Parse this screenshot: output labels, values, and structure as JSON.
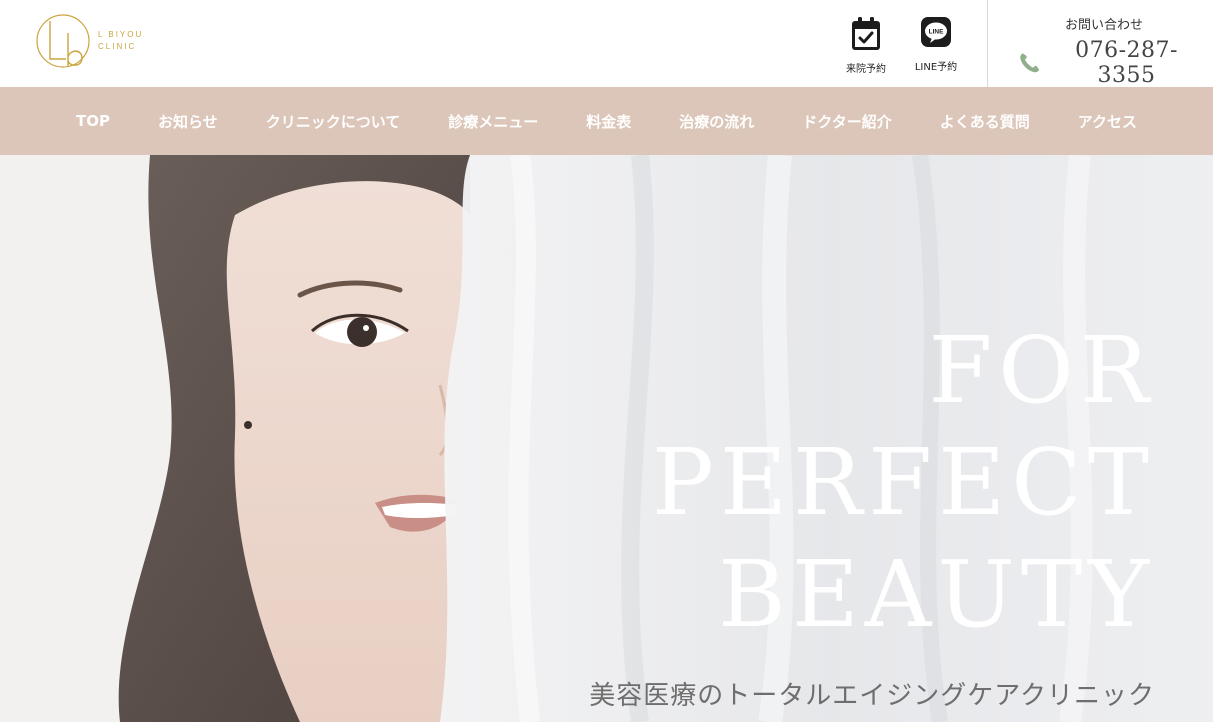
{
  "header": {
    "logo_text_line1": "L BIYOU",
    "logo_text_line2": "CLINIC",
    "visit_reserve_label": "来院予約",
    "line_reserve_label": "LINE予約",
    "line_badge": "LINE",
    "contact_label": "お問い合わせ",
    "phone_number": "076-287-3355"
  },
  "nav": {
    "items": [
      "TOP",
      "お知らせ",
      "クリニックについて",
      "診療メニュー",
      "料金表",
      "治療の流れ",
      "ドクター紹介",
      "よくある質問",
      "アクセス"
    ]
  },
  "hero": {
    "title_line1": "FOR",
    "title_line2": "PERFECT",
    "title_line3": "BEAUTY",
    "subtitle": "美容医療のトータルエイジングケアクリニック"
  },
  "colors": {
    "nav_bg": "#dcc6b9",
    "logo_gold": "#c9a53e",
    "phone_icon": "#8fb08a"
  }
}
